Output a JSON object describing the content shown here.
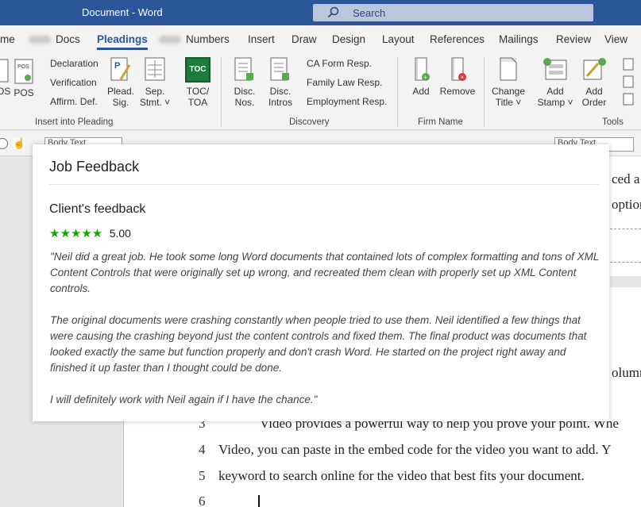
{
  "titlebar": {
    "title": "Document  -  Word",
    "search_placeholder": "Search"
  },
  "tabs": [
    {
      "label": "me"
    },
    {
      "label": "Docs"
    },
    {
      "label": "Pleadings"
    },
    {
      "label": "Numbers"
    },
    {
      "label": "Insert"
    },
    {
      "label": "Draw"
    },
    {
      "label": "Design"
    },
    {
      "label": "Layout"
    },
    {
      "label": "References"
    },
    {
      "label": "Mailings"
    },
    {
      "label": "Review"
    },
    {
      "label": "View"
    }
  ],
  "ribbon": {
    "insert_into_pleading": {
      "label": "Insert into Pleading",
      "pos": "POS",
      "pos_left": "POS",
      "declaration": "Declaration",
      "verification": "Verification",
      "affirm_def": "Affirm. Def.",
      "plead_sig_1": "Plead.",
      "plead_sig_2": "Sig.",
      "sep_stmt_1": "Sep.",
      "sep_stmt_2": "Stmt. ˅",
      "toc_icon": "TOC",
      "toc_toa_1": "TOC/",
      "toc_toa_2": "TOA"
    },
    "discovery": {
      "label": "Discovery",
      "disc_nos_1": "Disc.",
      "disc_nos_2": "Nos.",
      "disc_intros_1": "Disc.",
      "disc_intros_2": "Intros",
      "ca_form": "CA Form Resp.",
      "family_law": "Family Law Resp.",
      "employment": "Employment Resp."
    },
    "firm_name": {
      "label": "Firm Name",
      "add": "Add",
      "remove": "Remove"
    },
    "tools": {
      "label": "Tools",
      "change_title_1": "Change",
      "change_title_2": "Title ˅",
      "add_stamp_1": "Add",
      "add_stamp_2": "Stamp ˅",
      "add_order_1": "Add",
      "add_order_2": "Order"
    }
  },
  "qat": {
    "style_box_1": "Body Text",
    "style_box_2": "Body Text"
  },
  "document": {
    "lines": [
      {
        "num": "3",
        "text": "Video provides a powerful way to help you prove your point. Whe"
      },
      {
        "num": "4",
        "text": "Video, you can paste in the embed code for the video you want to add. Y"
      },
      {
        "num": "5",
        "text": "keyword to search online for the video that best fits your document."
      },
      {
        "num": "6",
        "text": ""
      }
    ],
    "fragment_1": "ced a",
    "fragment_2": "options",
    "fragment_3": "olumn"
  },
  "feedback": {
    "title": "Job Feedback",
    "subtitle": "Client's feedback",
    "stars": "★★★★★",
    "score": "5.00",
    "quote_p1": "\"Neil did a great job. He took some long Word documents that contained lots of complex formatting and tons of XML Content Controls that were originally set up wrong, and recreated them clean with properly set up XML Content controls.",
    "quote_p2": "The original documents were crashing constantly when people tried to use them. Neil identified a few things that were causing the crashing beyond just the content controls and fixed them. The final product was documents that looked exactly the same but function properly and don't crash Word. He started on the project right away and finished it up faster than I thought could be done.",
    "quote_p3": "I will definitely work with Neil again if I have the chance.\""
  },
  "colors": {
    "word_blue": "#2b579a",
    "star_green": "#14a800"
  }
}
